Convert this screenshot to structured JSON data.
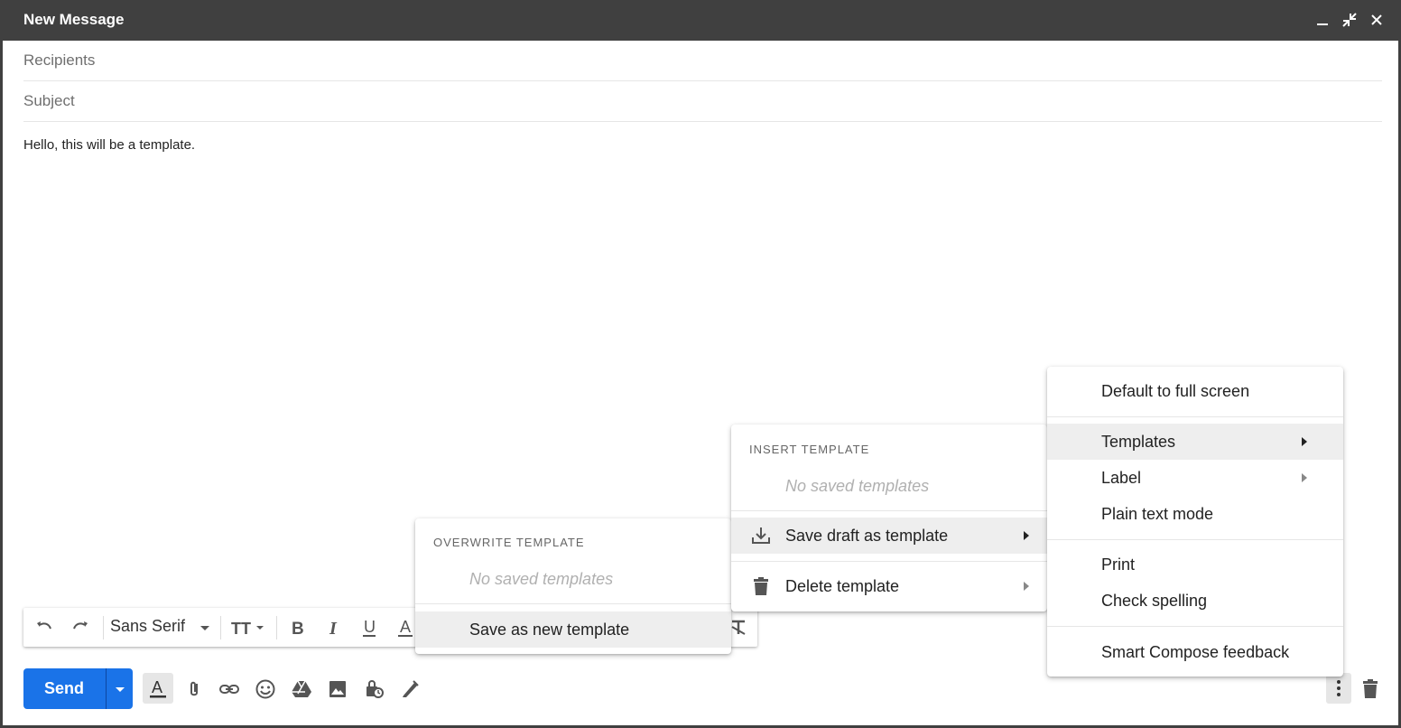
{
  "window": {
    "title": "New Message",
    "minimize_icon": "minimize-icon",
    "popout_icon": "exit-fullscreen-icon",
    "close_icon": "close-icon"
  },
  "fields": {
    "recipients_placeholder": "Recipients",
    "subject_placeholder": "Subject"
  },
  "body": {
    "text": "Hello, this will be a template."
  },
  "format_toolbar": {
    "font": "Sans Serif"
  },
  "send": {
    "label": "Send",
    "color": "#1a73e8"
  },
  "more_menu": {
    "items": [
      {
        "label": "Default to full screen"
      },
      {
        "label": "Templates",
        "active": true,
        "submenu": true
      },
      {
        "label": "Label",
        "submenu": true
      },
      {
        "label": "Plain text mode"
      },
      {
        "label": "Print"
      },
      {
        "label": "Check spelling"
      },
      {
        "label": "Smart Compose feedback"
      }
    ]
  },
  "templates_menu": {
    "insert_heading": "INSERT TEMPLATE",
    "insert_empty": "No saved templates",
    "save_label": "Save draft as template",
    "delete_label": "Delete template"
  },
  "save_menu": {
    "overwrite_heading": "OVERWRITE TEMPLATE",
    "overwrite_empty": "No saved templates",
    "save_new_label": "Save as new template"
  }
}
